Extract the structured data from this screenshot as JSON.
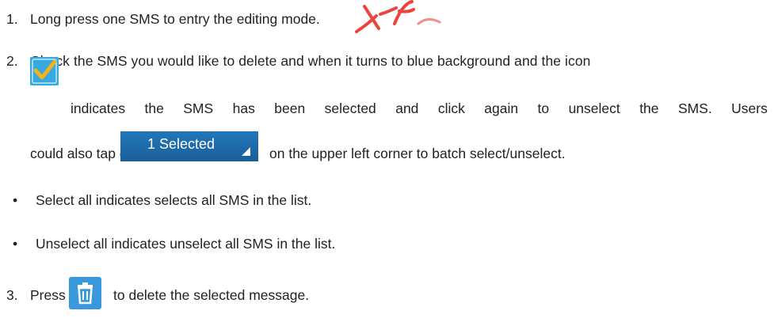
{
  "steps": {
    "s1_number": "1.",
    "s1_text": "Long press one SMS to entry the editing mode.",
    "s2_number": "2.",
    "s2_line1": "Check the SMS you would like to delete and when it turns to blue background and the icon",
    "s2_line2_words": [
      "indicates",
      "the",
      "SMS",
      "has",
      "been",
      "selected",
      "and",
      "click",
      "again",
      "to",
      "unselect",
      "the",
      "SMS.",
      "Users"
    ],
    "s2_line3_a": "could also tap on",
    "s2_line3_b": "on the upper left corner to batch select/unselect.",
    "bullet1": "Select all indicates selects all SMS in the list.",
    "bullet2": "Unselect all indicates unselect all SMS in the list.",
    "s3_number": "3.",
    "s3_a": "Press",
    "s3_b": "to delete the selected message."
  },
  "selected_chip": {
    "label": "1 Selected"
  },
  "icons": {
    "checkbox": "checkmark-icon",
    "trash": "trash-icon",
    "accent_blue": "#36a9e1",
    "chip_blue": "#1f6fb1",
    "watermark_red": "#e8302a"
  },
  "bullet_glyph": "•"
}
